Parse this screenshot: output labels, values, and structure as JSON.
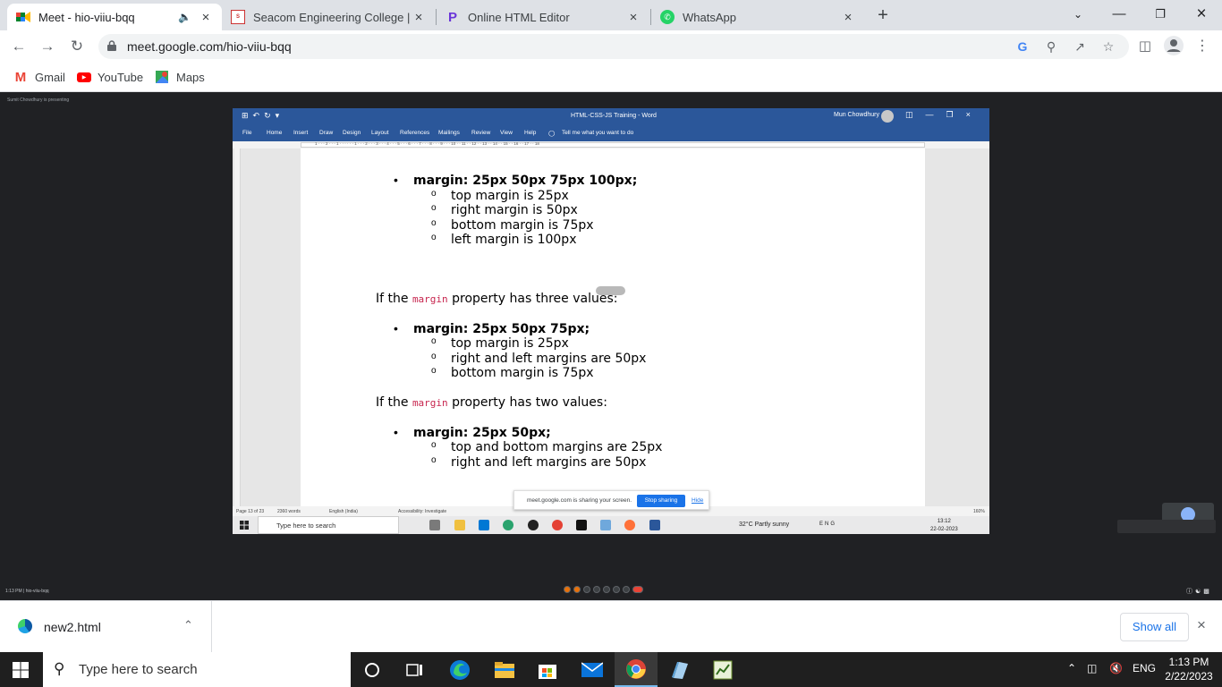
{
  "browser": {
    "tabs": [
      {
        "title": "Meet - hio-viiu-bqq",
        "favicon": "google-meet-icon",
        "audio": true,
        "active": true
      },
      {
        "title": "Seacom Engineering College | Be",
        "favicon": "seacom-logo-icon",
        "active": false
      },
      {
        "title": "Online HTML Editor",
        "favicon": "html-editor-icon",
        "active": false
      },
      {
        "title": "WhatsApp",
        "favicon": "whatsapp-icon",
        "active": false
      }
    ],
    "url": "meet.google.com/hio-viiu-bqq",
    "bookmarks": [
      {
        "label": "Gmail",
        "icon": "gmail-icon"
      },
      {
        "label": "YouTube",
        "icon": "youtube-icon"
      },
      {
        "label": "Maps",
        "icon": "maps-icon"
      }
    ]
  },
  "meet": {
    "presenting_label": "Sumit Chowdhury is presenting",
    "footer_left": "1:13 PM | hio-viiu-bqq"
  },
  "word": {
    "doc_title": "HTML-CSS-JS Training - Word",
    "user": "Mun Chowdhury",
    "menu": [
      "File",
      "Home",
      "Insert",
      "Draw",
      "Design",
      "Layout",
      "References",
      "Mailings",
      "Review",
      "View",
      "Help"
    ],
    "tell_me": "Tell me what you want to do",
    "ruler_numbers": "1 · · · 2 · · · 1 · · · · · · 1 · · · 2 · · · 3 · · · 4 · · · 5 · · · 6 · · · 7 · · · 8 · · · 9 · · · 10 · · 11 · · 12 · · 13 · · 14 · · 15 · · 16 · · 17 · · 18",
    "document": {
      "block1_heading": "margin: 25px 50px 75px 100px;",
      "block1_items": [
        "top margin is 25px",
        "right margin is 50px",
        "bottom margin is 75px",
        "left margin is 100px"
      ],
      "para2_prefix": "If the ",
      "para2_code": "margin",
      "para2_suffix": " property has three values:",
      "block2_heading": "margin: 25px 50px 75px;",
      "block2_items": [
        "top margin is 25px",
        "right and left margins are 50px",
        "bottom margin is 75px"
      ],
      "para3_prefix": "If the ",
      "para3_code": "margin",
      "para3_suffix": " property has two values:",
      "block3_heading": "margin: 25px 50px;",
      "block3_items": [
        "top and bottom margins are 25px",
        "right and left margins are 50px"
      ]
    },
    "status": {
      "page": "Page 13 of 23",
      "words": "2360 words",
      "language": "English (India)",
      "accessibility": "Accessibility: Investigate",
      "zoom": "160%"
    },
    "inner_taskbar": {
      "search_placeholder": "Type here to search",
      "weather": "32°C  Partly sunny",
      "lang": "ENG",
      "time": "13:12",
      "date": "22-02-2023"
    },
    "share_bar": {
      "message": "meet.google.com is sharing your screen.",
      "stop": "Stop sharing",
      "hide": "Hide"
    }
  },
  "downloads": {
    "file": "new2.html",
    "show_all": "Show all"
  },
  "taskbar": {
    "search_placeholder": "Type here to search",
    "lang": "ENG",
    "time": "1:13 PM",
    "date": "2/22/2023"
  },
  "colors": {
    "word_blue": "#2b579a",
    "meet_bg": "#202124",
    "chrome_tabstrip": "#dee1e6",
    "code_red": "#c7254e",
    "link_blue": "#1a73e8"
  }
}
